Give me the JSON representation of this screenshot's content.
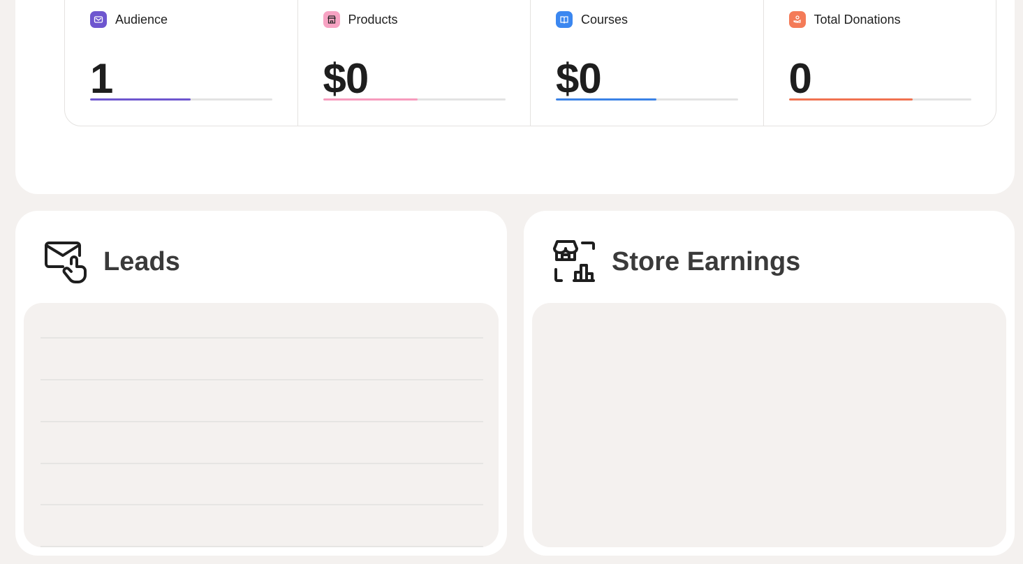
{
  "stats": [
    {
      "label": "Audience",
      "value": "1",
      "icon": "mail-icon",
      "color": "#6e56cf",
      "icon_bg": "#6e56cf",
      "progress": 0.55
    },
    {
      "label": "Products",
      "value": "$0",
      "icon": "store-icon",
      "color": "#f79bbd",
      "icon_bg": "#f7a3c3",
      "progress": 0.52
    },
    {
      "label": "Courses",
      "value": "$0",
      "icon": "book-icon",
      "color": "#3b82e6",
      "icon_bg": "#3b87f0",
      "progress": 0.55
    },
    {
      "label": "Total Donations",
      "value": "0",
      "icon": "donation-icon",
      "color": "#f07250",
      "icon_bg": "#f47b58",
      "progress": 0.68
    }
  ],
  "leads": {
    "title": "Leads",
    "icon": "mail-click-icon"
  },
  "store": {
    "title": "Store Earnings",
    "icon": "store-chart-icon"
  }
}
